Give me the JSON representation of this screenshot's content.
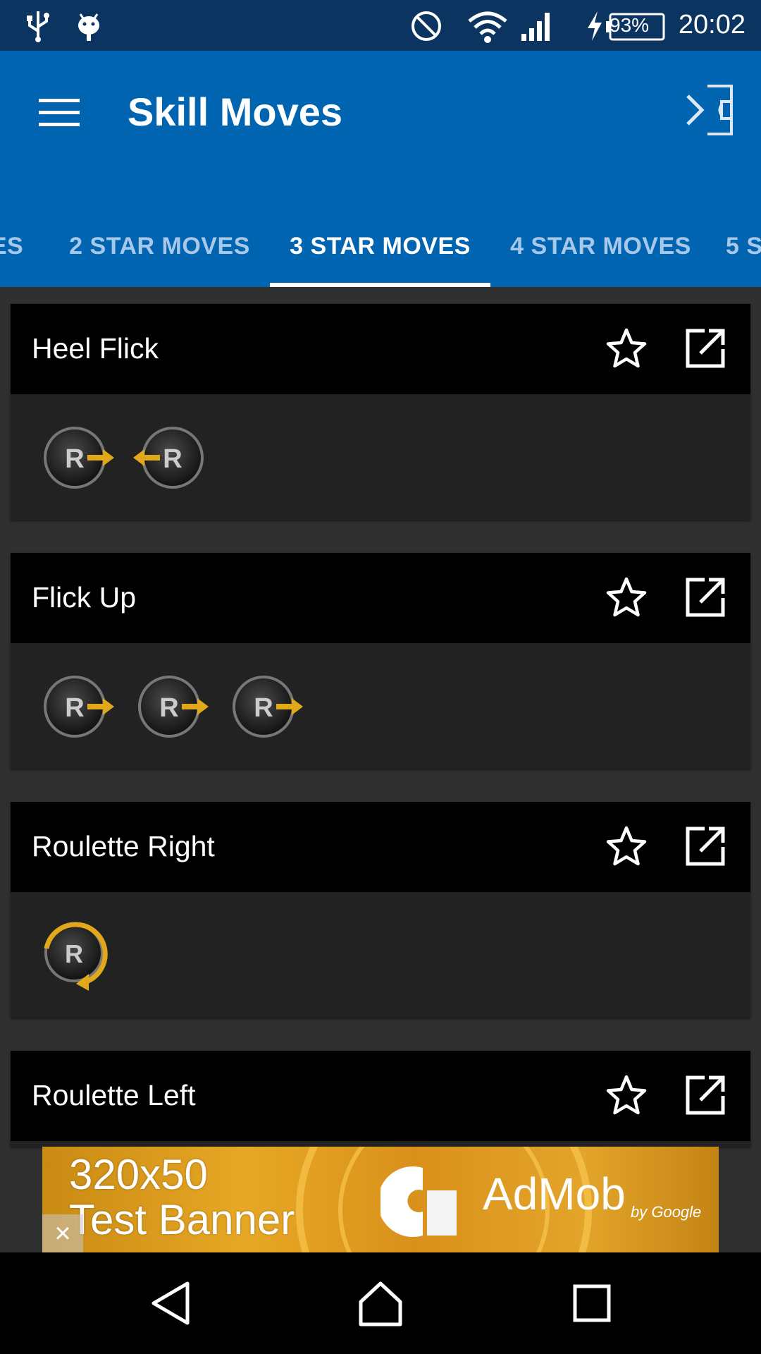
{
  "status_bar": {
    "time": "20:02",
    "battery": "93%",
    "icons": [
      "usb-icon",
      "android-debug-icon",
      "do-not-disturb-icon",
      "wifi-icon",
      "signal-icon",
      "charging-icon",
      "battery-icon"
    ]
  },
  "app_bar": {
    "title": "Skill Moves",
    "menu_icon": "hamburger-menu-icon",
    "exit_icon": "exit-to-pitch-icon"
  },
  "tabs": [
    {
      "label": "ES",
      "active": false
    },
    {
      "label": "2 STAR MOVES",
      "active": false
    },
    {
      "label": "3 STAR MOVES",
      "active": true
    },
    {
      "label": "4 STAR MOVES",
      "active": false
    },
    {
      "label": "5 S",
      "active": false
    }
  ],
  "cards": [
    {
      "title": "Heel Flick",
      "moves": [
        "R-flick-right",
        "R-flick-left"
      ]
    },
    {
      "title": "Flick Up",
      "moves": [
        "R-flick-right",
        "R-flick-right",
        "R-flick-right"
      ]
    },
    {
      "title": "Roulette Right",
      "moves": [
        "R-rotate-clockwise"
      ]
    },
    {
      "title": "Roulette Left",
      "moves": []
    }
  ],
  "ad": {
    "line1": "320x50",
    "line2": "Test Banner",
    "brand": "AdMob",
    "by": "by Google",
    "close": "×"
  },
  "colors": {
    "status_bar": "#0b3560",
    "app_bar": "#0064b0",
    "card_header": "#000000",
    "card_body": "#222222",
    "background": "#303030",
    "accent_arrow": "#e2a81b"
  }
}
